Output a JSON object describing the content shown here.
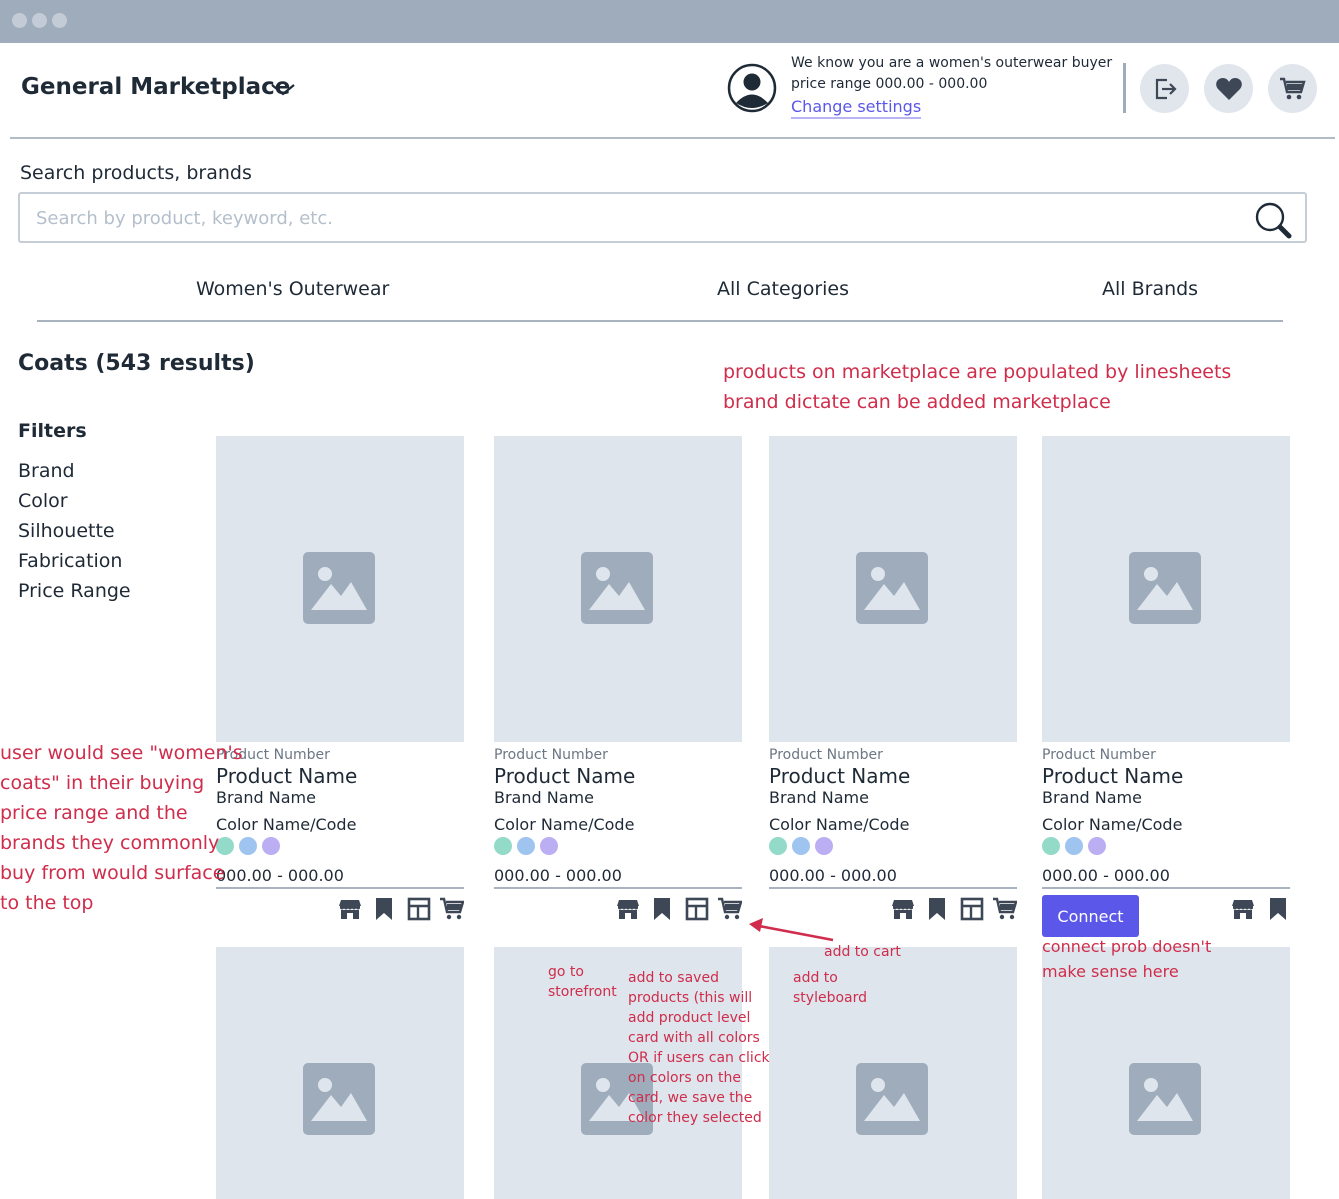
{
  "window": {
    "dots": 3
  },
  "header": {
    "title": "General Marketplace",
    "info_line1": "We know you are a women's outerwear buyer",
    "info_line2": "price range  000.00 - 000.00",
    "change_settings": "Change settings"
  },
  "search": {
    "label": "Search products, brands",
    "placeholder": "Search by product, keyword, etc."
  },
  "categories": [
    "Women's Outerwear",
    "All Categories",
    "All Brands"
  ],
  "results_title": "Coats (543 results)",
  "filters": {
    "title": "Filters",
    "items": [
      "Brand",
      "Color",
      "Silhouette",
      "Fabrication",
      "Price Range"
    ]
  },
  "swatch_colors": [
    "#93dac9",
    "#9fc4ef",
    "#bcaef3"
  ],
  "products": [
    {
      "number": "Product Number",
      "name": "Product Name",
      "brand": "Brand Name",
      "color": "Color Name/Code",
      "price": "000.00 - 000.00"
    },
    {
      "number": "Product Number",
      "name": "Product Name",
      "brand": "Brand Name",
      "color": "Color Name/Code",
      "price": "000.00 - 000.00"
    },
    {
      "number": "Product Number",
      "name": "Product Name",
      "brand": "Brand Name",
      "color": "Color Name/Code",
      "price": "000.00 - 000.00"
    },
    {
      "number": "Product Number",
      "name": "Product Name",
      "brand": "Brand Name",
      "color": "Color Name/Code",
      "price": "000.00 - 000.00",
      "connect_label": "Connect"
    }
  ],
  "annotations": {
    "top_line1": "products on marketplace are populated by linesheets",
    "top_line2": "brand dictate can be added marketplace",
    "left_lines": [
      "user would see \"women's",
      "coats\" in their buying",
      "price range and the",
      "brands they commonly",
      "buy from would surface",
      "to the top"
    ],
    "go_storefront": [
      "go to",
      "storefront"
    ],
    "add_saved": [
      "add to saved",
      "products (this will",
      "add product level",
      "card with all colors",
      "OR if users can click",
      "on colors on the",
      "card, we save the",
      "color they selected"
    ],
    "add_styleboard": [
      "add to",
      "styleboard"
    ],
    "add_cart": "add to cart",
    "connect_note": [
      "connect prob doesn't",
      "make sense here"
    ]
  }
}
